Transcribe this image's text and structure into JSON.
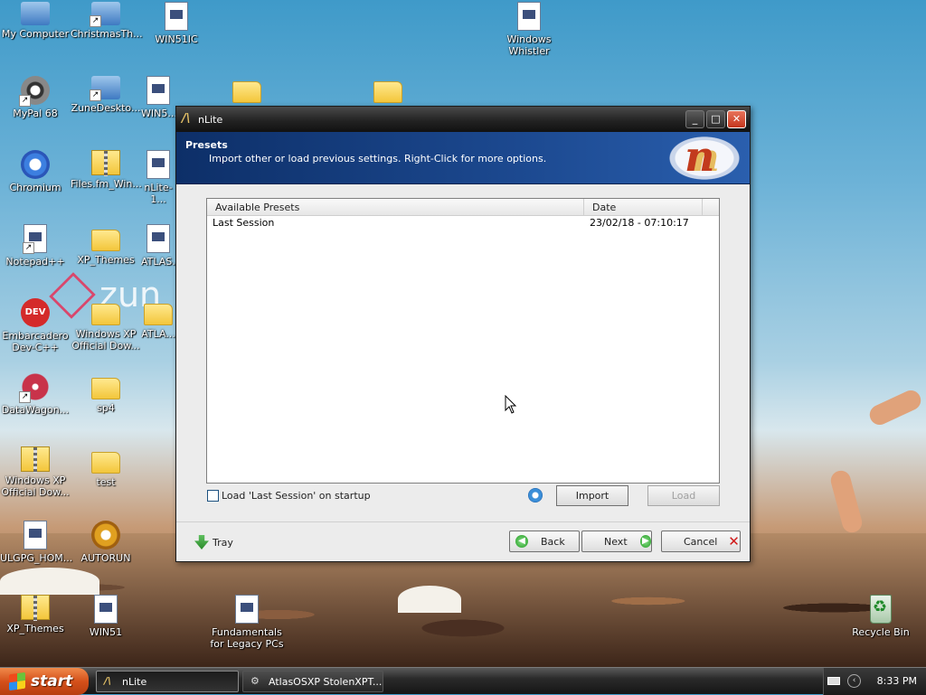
{
  "desktop": {
    "icons": [
      {
        "label": "My Computer",
        "icon": "my-computer-icon"
      },
      {
        "label": "ChristmasTh...",
        "icon": "installer-icon"
      },
      {
        "label": "WIN51IC",
        "icon": "file-icon"
      },
      {
        "label": "Windows\nWhistler",
        "icon": "image-file-icon"
      },
      {
        "label": "MyPal 68",
        "icon": "mypal-icon"
      },
      {
        "label": "ZuneDeskto...",
        "icon": "installer-icon"
      },
      {
        "label": "WIN5...",
        "icon": "file-icon"
      },
      {
        "label": "",
        "icon": "folder-icon"
      },
      {
        "label": "",
        "icon": "folder-icon"
      },
      {
        "label": "Chromium",
        "icon": "chromium-icon"
      },
      {
        "label": "Files.fm_Win...",
        "icon": "zip-folder-icon"
      },
      {
        "label": "nLite-1...",
        "icon": "nlite-icon"
      },
      {
        "label": "Notepad++",
        "icon": "notepad-plus-plus-icon"
      },
      {
        "label": "XP_Themes",
        "icon": "folder-icon"
      },
      {
        "label": "ATLAS...",
        "icon": "file-icon"
      },
      {
        "label": "Embarcadero\nDev-C++",
        "icon": "dev-cpp-icon"
      },
      {
        "label": "Windows XP\nOfficial Dow...",
        "icon": "folder-icon"
      },
      {
        "label": "ATLA...",
        "icon": "folder-icon"
      },
      {
        "label": "DataWagon...",
        "icon": "datawagon-icon"
      },
      {
        "label": "sp4",
        "icon": "folder-icon"
      },
      {
        "label": "Windows XP\nOfficial Dow...",
        "icon": "zip-folder-icon"
      },
      {
        "label": "test",
        "icon": "folder-icon"
      },
      {
        "label": "ULGPG_HOM...",
        "icon": "file-icon"
      },
      {
        "label": "AUTORUN",
        "icon": "autorun-icon"
      },
      {
        "label": "XP_Themes",
        "icon": "zip-folder-icon"
      },
      {
        "label": "WIN51",
        "icon": "file-icon"
      },
      {
        "label": "Fundamentals\nfor Legacy PCs",
        "icon": "image-file-icon"
      },
      {
        "label": "Recycle Bin",
        "icon": "recycle-bin-icon"
      }
    ],
    "wallpaper_logo": "zun"
  },
  "window": {
    "title": "nLite",
    "controls": {
      "minimize": "_",
      "maximize": "□",
      "close": "✕"
    },
    "header": {
      "title": "Presets",
      "subtitle": "Import other or load previous settings. Right-Click for more options."
    },
    "presets_list": {
      "columns": [
        "Available Presets",
        "Date"
      ],
      "rows": [
        {
          "name": "Last Session",
          "date": "23/02/18 - 07:10:17"
        }
      ]
    },
    "load_last_session": {
      "label": "Load 'Last Session' on startup",
      "checked": false
    },
    "buttons": {
      "import": "Import",
      "load": "Load",
      "tray": "Tray",
      "back": "Back",
      "next": "Next",
      "cancel": "Cancel"
    }
  },
  "taskbar": {
    "start_label": "start",
    "tasks": [
      {
        "label": "nLite",
        "active": true
      },
      {
        "label": "AtlasOSXP StolenXPT...",
        "active": false
      }
    ],
    "clock": "8:33 PM"
  },
  "colors": {
    "header_bg": "#1c4990",
    "start_button": "#d4501a",
    "close_button": "#c4361d"
  }
}
